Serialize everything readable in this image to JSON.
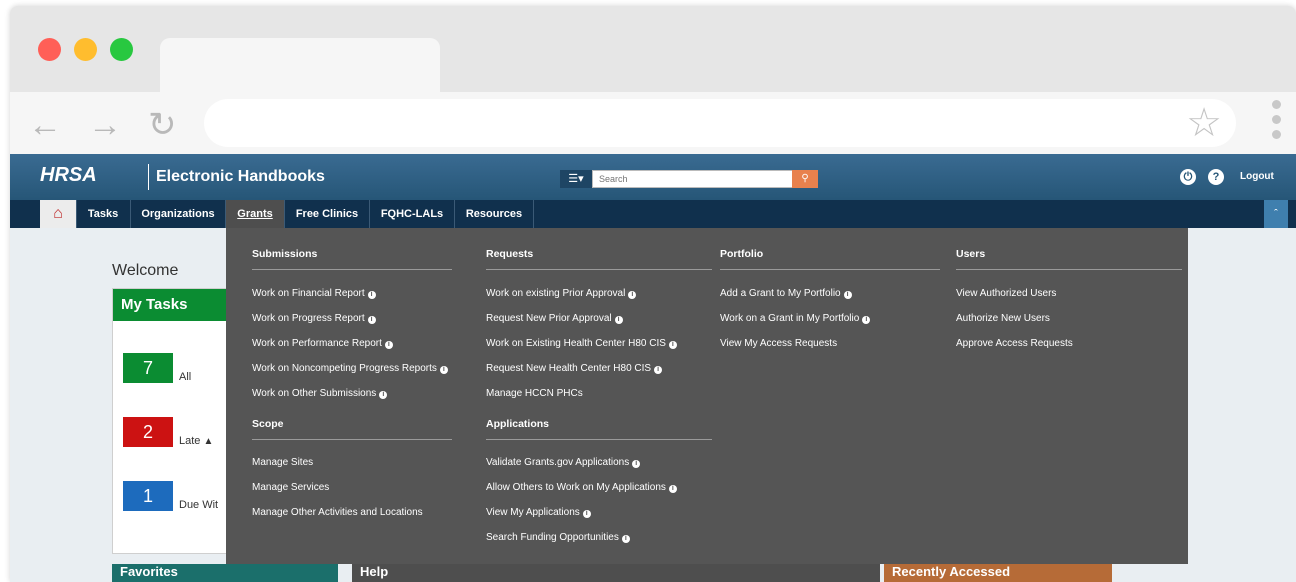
{
  "browser": {
    "traffic_lights": [
      "#ff5f57",
      "#ffbd2e",
      "#28c840"
    ],
    "back_icon": "←",
    "forward_icon": "→",
    "reload_icon": "↻",
    "star_icon": "☆"
  },
  "header": {
    "logo_text": "HRSA",
    "title": "Electronic Handbooks",
    "menu_toggle": "☰▾",
    "search_placeholder": "Search",
    "search_icon": "⚲",
    "user_icon": "⏻",
    "help_icon": "?",
    "logout_label": "Logout"
  },
  "nav": {
    "home_icon": "⌂",
    "items": [
      "Tasks",
      "Organizations",
      "Grants",
      "Free Clinics",
      "FQHC-LALs",
      "Resources"
    ],
    "collapse_icon": "ˆ"
  },
  "main": {
    "welcome": "Welcome",
    "tasks_title": "My Tasks",
    "tasks": [
      {
        "count": "7",
        "label": "All",
        "color": "#0b8c32"
      },
      {
        "count": "2",
        "label": "Late",
        "color": "#cc1212"
      },
      {
        "count": "1",
        "label": "Due Wit",
        "color": "#1d6bbd"
      }
    ],
    "late_icon": "▲",
    "bottom_panels": [
      {
        "label": "Favorites",
        "color": "#1b6f6b"
      },
      {
        "label": "Help",
        "color": "#4e4e4e"
      },
      {
        "label": "Recently Accessed",
        "color": "#b66b37"
      }
    ]
  },
  "menu": {
    "submissions": {
      "heading": "Submissions",
      "links": [
        "Work on Financial Report",
        "Work on Progress Report",
        "Work on Performance Report",
        "Work on Noncompeting Progress Reports",
        "Work on Other Submissions"
      ]
    },
    "scope": {
      "heading": "Scope",
      "links": [
        "Manage Sites",
        "Manage Services",
        "Manage Other Activities and Locations"
      ]
    },
    "requests": {
      "heading": "Requests",
      "links": [
        "Work on existing Prior Approval",
        "Request New Prior Approval",
        "Work on Existing Health Center H80 CIS",
        "Request New Health Center H80 CIS",
        "Manage HCCN PHCs"
      ]
    },
    "applications": {
      "heading": "Applications",
      "links": [
        "Validate Grants.gov Applications",
        "Allow Others to Work on My Applications",
        "View My Applications",
        "Search Funding Opportunities"
      ]
    },
    "portfolio": {
      "heading": "Portfolio",
      "links": [
        "Add a Grant to My Portfolio",
        "Work on a Grant in My Portfolio",
        "View My Access Requests"
      ]
    },
    "users": {
      "heading": "Users",
      "links": [
        "View Authorized Users",
        "Authorize New Users",
        "Approve Access Requests"
      ]
    },
    "info_glyph": "i"
  }
}
